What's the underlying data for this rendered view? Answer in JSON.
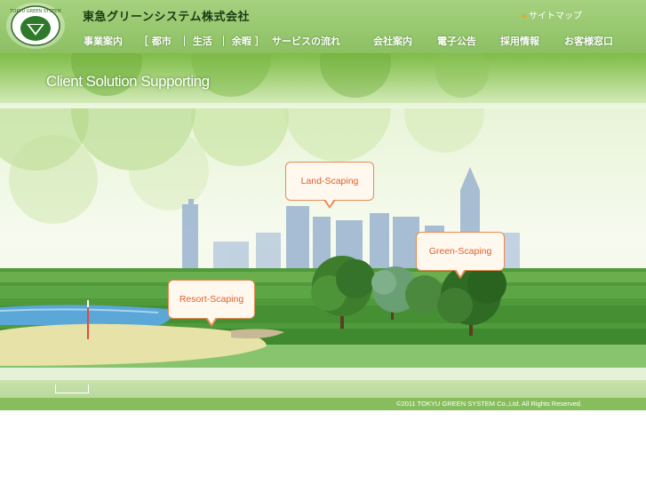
{
  "header": {
    "logo_text": "TOKYU GREEN SYSTEM",
    "company_name": "東急グリーンシステム株式会社",
    "sitemap_label": "サイトマップ"
  },
  "nav": {
    "items": [
      {
        "label": "事業案内"
      },
      {
        "label": "［ 都市"
      },
      {
        "label": "｜ 生活"
      },
      {
        "label": "｜ 余暇 ］"
      },
      {
        "label": "サービスの流れ"
      },
      {
        "label": "会社案内"
      },
      {
        "label": "電子公告"
      },
      {
        "label": "採用情報"
      },
      {
        "label": "お客様窓口"
      }
    ]
  },
  "banner": {
    "title": "Client Solution Supporting"
  },
  "scene": {
    "bubbles": {
      "land": "Land-Scaping",
      "green": "Green-Scaping",
      "resort": "Resort-Scaping"
    }
  },
  "footer": {
    "copyright": "©2011 TOKYU GREEN SYSTEM Co.,Ltd. All Rights Reserved."
  },
  "colors": {
    "header_green": "#8cc063",
    "bubble_border": "#e88a52",
    "bubble_text": "#e0612b",
    "footer_green": "#88bd5e"
  }
}
